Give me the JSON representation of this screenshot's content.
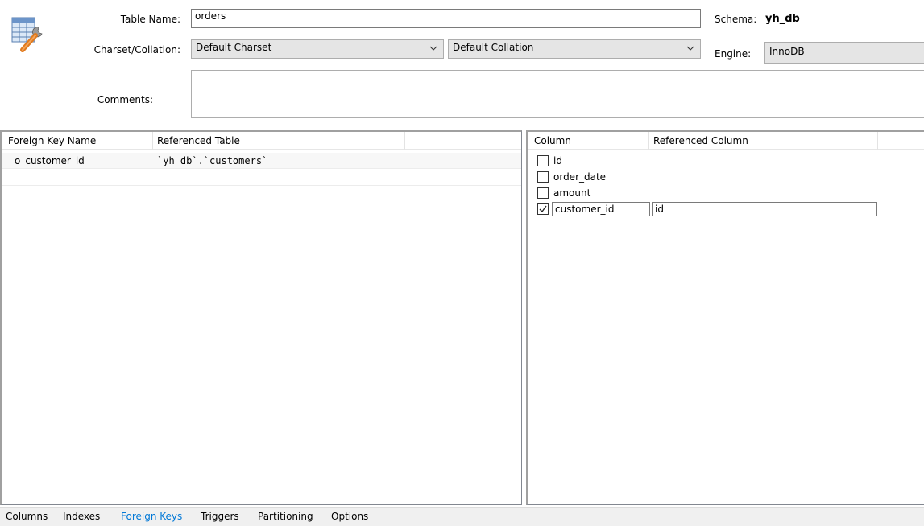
{
  "form": {
    "table_name_label": "Table Name:",
    "table_name_value": "orders",
    "schema_label": "Schema:",
    "schema_value": "yh_db",
    "charset_label": "Charset/Collation:",
    "charset_value": "Default Charset",
    "collation_value": "Default Collation",
    "engine_label": "Engine:",
    "engine_value": "InnoDB",
    "comments_label": "Comments:",
    "comments_value": ""
  },
  "fk_grid": {
    "headers": [
      "Foreign Key Name",
      "Referenced Table"
    ],
    "rows": [
      {
        "name": "o_customer_id",
        "table": "`yh_db`.`customers`"
      }
    ]
  },
  "column_grid": {
    "headers": [
      "Column",
      "Referenced Column"
    ],
    "rows": [
      {
        "column": "id",
        "checked": false,
        "referenced": ""
      },
      {
        "column": "order_date",
        "checked": false,
        "referenced": ""
      },
      {
        "column": "amount",
        "checked": false,
        "referenced": ""
      },
      {
        "column": "customer_id",
        "checked": true,
        "referenced": "id"
      }
    ]
  },
  "tabs": {
    "items": [
      "Columns",
      "Indexes",
      "Foreign Keys",
      "Triggers",
      "Partitioning",
      "Options"
    ],
    "active": "Foreign Keys"
  },
  "icons": {
    "table_editor": "table-wrench-icon",
    "dropdown": "chevron-down-icon",
    "checkbox": "checkbox-icon"
  },
  "colors": {
    "active_tab": "#0078d7",
    "panel_border": "#a0a0a0",
    "select_bg": "#e5e5e5",
    "tabbar_bg": "#f0f0f0"
  }
}
